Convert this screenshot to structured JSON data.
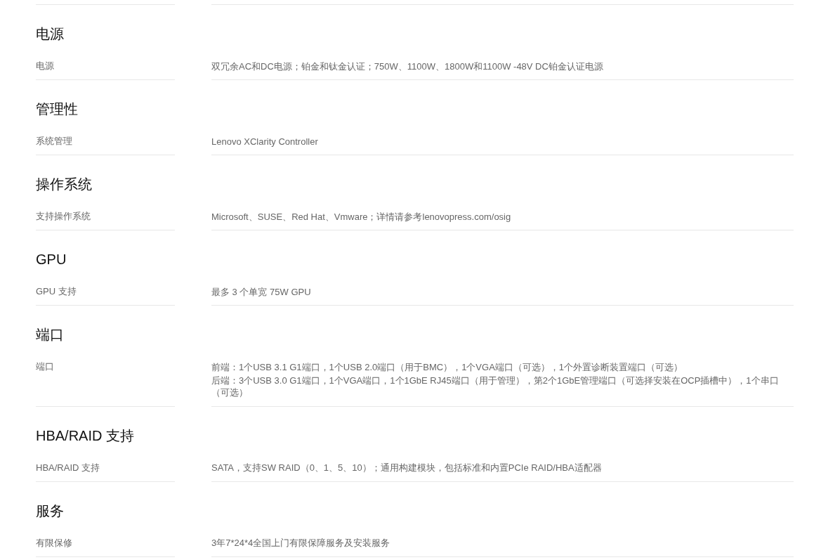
{
  "sections": [
    {
      "heading": "电源",
      "rows": [
        {
          "label": "电源",
          "values": [
            "双冗余AC和DC电源；铂金和钛金认证；750W、1100W、1800W和1100W -48V DC铂金认证电源"
          ]
        }
      ]
    },
    {
      "heading": "管理性",
      "rows": [
        {
          "label": "系统管理",
          "values": [
            "Lenovo XClarity Controller"
          ]
        }
      ]
    },
    {
      "heading": "操作系统",
      "rows": [
        {
          "label": "支持操作系统",
          "values": [
            "Microsoft、SUSE、Red Hat、Vmware；详情请参考lenovopress.com/osig"
          ]
        }
      ]
    },
    {
      "heading": "GPU",
      "rows": [
        {
          "label": "GPU 支持",
          "values": [
            "最多 3 个单宽 75W GPU"
          ]
        }
      ]
    },
    {
      "heading": "端口",
      "rows": [
        {
          "label": "端口",
          "values": [
            "前端：1个USB 3.1 G1端口，1个USB 2.0端口（用于BMC），1个VGA端口（可选），1个外置诊断装置端口（可选）",
            "后端：3个USB 3.0 G1端口，1个VGA端口，1个1GbE RJ45端口（用于管理），第2个1GbE管理端口（可选择安装在OCP插槽中），1个串口（可选）"
          ]
        }
      ]
    },
    {
      "heading": "HBA/RAID 支持",
      "rows": [
        {
          "label": "HBA/RAID 支持",
          "values": [
            "SATA，支持SW RAID（0、1、5、10）；通用构建模块，包括标准和内置PCIe RAID/HBA适配器"
          ]
        }
      ]
    },
    {
      "heading": "服务",
      "rows": [
        {
          "label": "有限保修",
          "values": [
            "3年7*24*4全国上门有限保障服务及安装服务"
          ]
        }
      ]
    }
  ]
}
